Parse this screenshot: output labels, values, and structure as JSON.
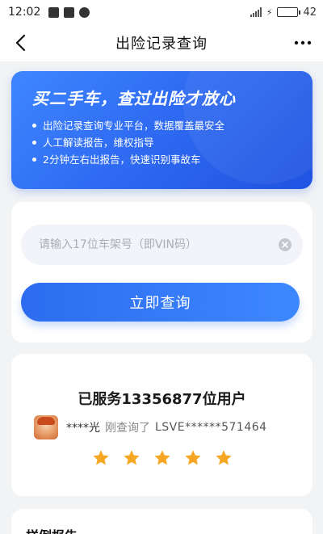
{
  "status_bar": {
    "time": "12:02",
    "battery_level_text": "42",
    "battery_fraction": 0.42,
    "battery_color": "#3fc23f"
  },
  "nav": {
    "title": "出险记录查询",
    "back_icon": "chevron-left-icon",
    "more_icon": "more-horizontal-icon"
  },
  "hero": {
    "title": "买二手车，查过出险才放心",
    "bullets": [
      "出险记录查询专业平台，数据覆盖最安全",
      "人工解读报告，维权指导",
      "2分钟左右出报告，快速识别事故车"
    ],
    "gradient_colors": [
      "#3f86ff",
      "#1f52e0"
    ]
  },
  "query": {
    "vin_placeholder": "请输入17位车架号（即VIN码）",
    "vin_value": "",
    "submit_label": "立即查询",
    "button_color": "#2d6cf0"
  },
  "served": {
    "title": "已服务13356877位用户",
    "activity": {
      "user": "****光",
      "action": "刚查询了",
      "vin": "LSVE******571464"
    },
    "rating": 5,
    "star_color": "#f5a623"
  },
  "sample": {
    "title": "样例报告"
  }
}
